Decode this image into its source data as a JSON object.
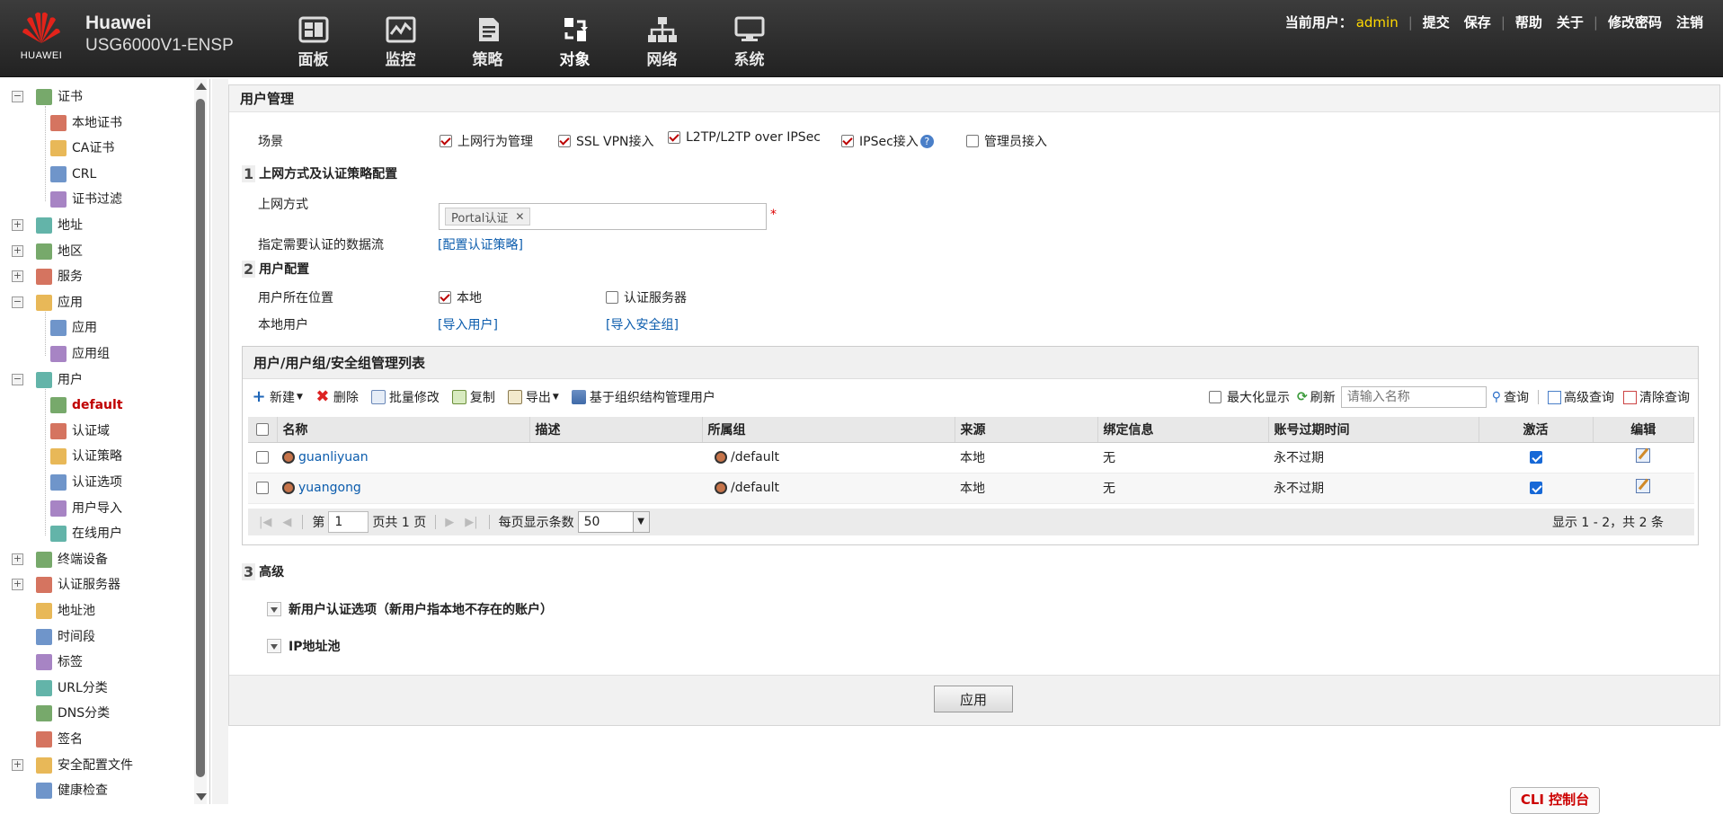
{
  "header": {
    "logo_text": "HUAWEI",
    "brand": "Huawei",
    "model": "USG6000V1-ENSP",
    "nav": [
      {
        "label": "面板",
        "icon": "dashboard-icon"
      },
      {
        "label": "监控",
        "icon": "monitor-icon"
      },
      {
        "label": "策略",
        "icon": "policy-icon"
      },
      {
        "label": "对象",
        "icon": "object-icon"
      },
      {
        "label": "网络",
        "icon": "network-icon"
      },
      {
        "label": "系统",
        "icon": "system-icon"
      }
    ],
    "current_user_label": "当前用户：",
    "username": "admin",
    "links": [
      "提交",
      "保存",
      "帮助",
      "关于",
      "修改密码",
      "注销"
    ]
  },
  "sidebar": {
    "items": [
      {
        "label": "证书",
        "icon": "certificate-icon",
        "expander": "−"
      },
      {
        "label": "本地证书",
        "icon": "local-cert-icon"
      },
      {
        "label": "CA证书",
        "icon": "ca-cert-icon"
      },
      {
        "label": "CRL",
        "icon": "crl-icon"
      },
      {
        "label": "证书过滤",
        "icon": "cert-filter-icon"
      },
      {
        "label": "地址",
        "icon": "address-icon",
        "expander": "+"
      },
      {
        "label": "地区",
        "icon": "region-icon",
        "expander": "+"
      },
      {
        "label": "服务",
        "icon": "service-icon",
        "expander": "+"
      },
      {
        "label": "应用",
        "icon": "application-icon",
        "expander": "−"
      },
      {
        "label": "应用",
        "icon": "application-icon"
      },
      {
        "label": "应用组",
        "icon": "application-group-icon"
      },
      {
        "label": "用户",
        "icon": "user-icon",
        "expander": "−"
      },
      {
        "label": "default",
        "icon": "user-default-icon",
        "selected": true
      },
      {
        "label": "认证域",
        "icon": "auth-domain-icon"
      },
      {
        "label": "认证策略",
        "icon": "auth-policy-icon"
      },
      {
        "label": "认证选项",
        "icon": "auth-option-icon"
      },
      {
        "label": "用户导入",
        "icon": "user-import-icon"
      },
      {
        "label": "在线用户",
        "icon": "online-user-icon"
      },
      {
        "label": "终端设备",
        "icon": "terminal-icon",
        "expander": "+"
      },
      {
        "label": "认证服务器",
        "icon": "auth-server-icon",
        "expander": "+"
      },
      {
        "label": "地址池",
        "icon": "address-pool-icon"
      },
      {
        "label": "时间段",
        "icon": "time-range-icon"
      },
      {
        "label": "标签",
        "icon": "tag-icon"
      },
      {
        "label": "URL分类",
        "icon": "url-category-icon"
      },
      {
        "label": "DNS分类",
        "icon": "dns-category-icon"
      },
      {
        "label": "签名",
        "icon": "signature-icon"
      },
      {
        "label": "安全配置文件",
        "icon": "security-profile-icon",
        "expander": "+"
      },
      {
        "label": "健康检查",
        "icon": "health-check-icon"
      }
    ]
  },
  "main": {
    "title": "用户管理",
    "scene": {
      "label": "场景",
      "options": [
        {
          "label": "上网行为管理",
          "checked": true
        },
        {
          "label": "SSL VPN接入",
          "checked": true
        },
        {
          "label": "L2TP/L2TP over IPSec",
          "checked": true
        },
        {
          "label": "IPSec接入",
          "checked": true
        },
        {
          "label": "管理员接入",
          "checked": false
        }
      ]
    },
    "section1": {
      "num": "1",
      "title": "上网方式及认证策略配置",
      "access_label": "上网方式",
      "access_tag": "Portal认证",
      "required_mark": "*",
      "flow_label": "指定需要认证的数据流",
      "flow_link": "[配置认证策略]"
    },
    "section2": {
      "num": "2",
      "title": "用户配置",
      "location_label": "用户所在位置",
      "local_label": "本地",
      "local_checked": true,
      "server_label": "认证服务器",
      "server_checked": false,
      "local_user_label": "本地用户",
      "import_users": "[导入用户]",
      "import_groups": "[导入安全组]"
    },
    "grid": {
      "title": "用户/用户组/安全组管理列表",
      "toolbar": {
        "new": "新建",
        "delete": "删除",
        "batch_edit": "批量修改",
        "copy": "复制",
        "export": "导出",
        "org_manage": "基于组织结构管理用户",
        "maximize": "最大化显示",
        "refresh": "刷新",
        "search_placeholder": "请输入名称",
        "search": "查询",
        "advanced_search": "高级查询",
        "clear_search": "清除查询"
      },
      "columns": [
        "名称",
        "描述",
        "所属组",
        "来源",
        "绑定信息",
        "账号过期时间",
        "激活",
        "编辑"
      ],
      "rows": [
        {
          "name": "guanliyuan",
          "desc": "",
          "group": "/default",
          "source": "本地",
          "binding": "无",
          "expire": "永不过期",
          "active": true
        },
        {
          "name": "yuangong",
          "desc": "",
          "group": "/default",
          "source": "本地",
          "binding": "无",
          "expire": "永不过期",
          "active": true
        }
      ],
      "pager": {
        "page_prefix": "第",
        "page_value": "1",
        "page_suffix": "页共 1 页",
        "per_page_label": "每页显示条数",
        "per_page": "50",
        "status": "显示 1 - 2，共 2 条"
      }
    },
    "section3": {
      "num": "3",
      "title": "高级",
      "items": [
        "新用户认证选项（新用户指本地不存在的账户）",
        "IP地址池"
      ]
    },
    "apply_button": "应用"
  },
  "cli_button": "CLI 控制台"
}
